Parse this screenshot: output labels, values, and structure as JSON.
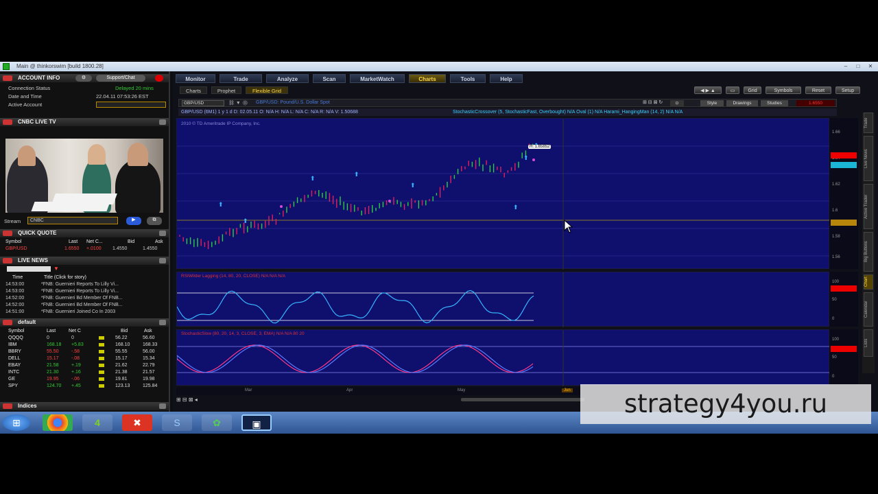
{
  "window": {
    "title": "Main @ thinkorswim [build 1800.28]"
  },
  "left_panel": {
    "account": {
      "header": "ACCOUNT INFO",
      "support_button": "Support/Chat",
      "rows": [
        {
          "label": "Connection Status",
          "value": "Delayed 20 mins"
        },
        {
          "label": "Date and Time",
          "value": "22.04.11 07:53:26 EST"
        },
        {
          "label": "Active Account",
          "value": ""
        }
      ]
    },
    "live_tv": {
      "header": "CNBC LIVE TV",
      "stream_label": "Stream",
      "stream_value": "CNBC"
    },
    "quick_quote": {
      "header": "QUICK QUOTE",
      "columns": [
        "Symbol",
        "Last",
        "Net C...",
        "Bid",
        "Ask"
      ],
      "row": {
        "symbol": "GBP/USD",
        "last": "1.6550",
        "net": "+.0100",
        "bid": "1.4550",
        "ask": "1.4550"
      }
    },
    "live_news": {
      "header": "LIVE NEWS",
      "columns": [
        "Time",
        "Title (Click for story)"
      ],
      "items": [
        {
          "time": "14:53:00",
          "title": "*FNB: Guernieri Reports To Lilly Vi..."
        },
        {
          "time": "14:53:00",
          "title": "*FNB: Guernieri Reports To Lilly Vi..."
        },
        {
          "time": "14:52:00",
          "title": "*FNB: Guernieri Bd Member Of FNB..."
        },
        {
          "time": "14:52:00",
          "title": "*FNB: Guernieri Bd Member Of FNB..."
        },
        {
          "time": "14:51:00",
          "title": "*FNB: Guernieri Joined Co In 2003"
        }
      ]
    },
    "watchlist": {
      "header": "default",
      "columns": [
        "Symbol",
        "Last",
        "Net C",
        "Bid",
        "Ask"
      ],
      "rows": [
        {
          "symbol": "QQQQ",
          "last": "0",
          "net": "0",
          "bid": "56.22",
          "ask": "56.60"
        },
        {
          "symbol": "IBM",
          "last": "168.18",
          "net": "+5.83",
          "bid": "168.10",
          "ask": "168.33"
        },
        {
          "symbol": "BBRY",
          "last": "55.50",
          "net": "-.58",
          "bid": "55.55",
          "ask": "56.00"
        },
        {
          "symbol": "DELL",
          "last": "15.17",
          "net": "-.08",
          "bid": "15.17",
          "ask": "15.34"
        },
        {
          "symbol": "EBAY",
          "last": "21.58",
          "net": "+.19",
          "bid": "21.62",
          "ask": "22.79"
        },
        {
          "symbol": "INTC",
          "last": "21.30",
          "net": "+.16",
          "bid": "21.38",
          "ask": "21.57"
        },
        {
          "symbol": "GE",
          "last": "19.95",
          "net": "-.06",
          "bid": "19.81",
          "ask": "19.98"
        },
        {
          "symbol": "SPY",
          "last": "124.70",
          "net": "+.45",
          "bid": "123.13",
          "ask": "125.84"
        }
      ]
    },
    "indices_header": "Indices"
  },
  "main": {
    "tabs": [
      "Monitor",
      "Trade",
      "Analyze",
      "Scan",
      "MarketWatch",
      "Charts",
      "Tools",
      "Help"
    ],
    "active_tab": "Charts",
    "subtabs": [
      "Charts",
      "Prophet",
      "Flexible Grid"
    ],
    "toolbar_buttons": [
      "Grid",
      "Symbols",
      "Reset",
      "Setup"
    ],
    "chart_buttons": [
      "Style",
      "Drawings",
      "Studies"
    ],
    "symbol": "GBP/USD",
    "symbol_desc": "GBP/USD: Pound/U.S. Dollar Spot",
    "quote_line": "GBP/USD (6M1) 1 y 1 d   D: 02.05.11   O: N/A   H: N/A   L: N/A   C: N/A   R: N/A   V: 1.50688",
    "study_line1": "StochasticCrossover (5, StochasticFast, Overbought)   N/A   Oval (1)   N/A   Harami_HangingMan (14, 2)   N/A   N/A",
    "copyright": "2010 © TD Ameritrade IP Company, Inc.",
    "price_tag": "H: 1.65852",
    "price_labels": [
      "1.66",
      "1.64",
      "1.62",
      "1.6",
      "1.58",
      "1.56"
    ],
    "right_flag": "1.6550",
    "rsi_label": "RSIWilder Lagging (14, 80, 20, CLOSE)   N/A   N/A   N/A",
    "rsi_labels": [
      "100",
      "50",
      "0"
    ],
    "stoch_label": "StochasticSlow (80, 20, 14, 3, CLOSE, 3, EMA)   N/A   N/A   80   20",
    "stoch_labels": [
      "100",
      "50",
      "0"
    ],
    "date_labels": [
      "Mar",
      "Apr",
      "May",
      "Jun"
    ],
    "side_tabs": [
      "Trade",
      "Live News",
      "Active Trader",
      "Big Buttons",
      "Chart",
      "Calendar",
      "Lists"
    ]
  },
  "colors": {
    "pane_bg": "#0f0f6e",
    "up_candle": "#2ecc40",
    "down_candle": "#e0205a",
    "rsi_line": "#37b6ff",
    "stoch_k": "#ff3a8a",
    "stoch_d": "#5a7bff",
    "accent": "#ffd84a"
  },
  "taskbar_icons": [
    "windows-start-icon",
    "chrome-icon",
    "thinkorswim-icon",
    "tool-icon",
    "skype-icon",
    "clover-icon",
    "window-icon"
  ],
  "watermark": "strategy4you.ru"
}
